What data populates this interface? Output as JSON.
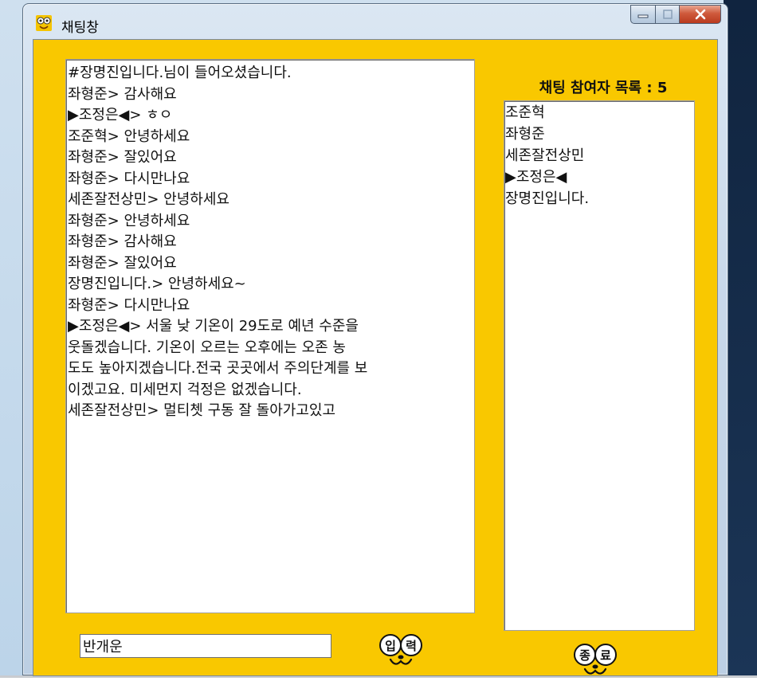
{
  "window": {
    "title": "채팅창",
    "minimize_glyph": "▬",
    "maximize_glyph": "□",
    "close_glyph": "X"
  },
  "chat": {
    "lines": [
      "#장명진입니다.님이 들어오셨습니다.",
      "좌형준> 감사해요",
      "▶조정은◀> ㅎㅇ",
      "조준혁> 안녕하세요",
      "좌형준> 잘있어요",
      "좌형준> 다시만나요",
      "세존잘전상민> 안녕하세요",
      "좌형준> 안녕하세요",
      "좌형준> 감사해요",
      "좌형준> 잘있어요",
      "장명진입니다.> 안녕하세요~",
      "좌형준> 다시만나요",
      "▶조정은◀> 서울 낮 기온이 29도로 예년 수준을",
      " 웃돌겠습니다. 기온이 오르는 오후에는 오존 농",
      "도도 높아지겠습니다.전국 곳곳에서 주의단계를 보",
      "이겠고요. 미세먼지 걱정은 없겠습니다.",
      "세존잘전상민> 멀티쳇 구동 잘 돌아가고있고"
    ]
  },
  "participants": {
    "title": "채팅 참여자 목록 : 5",
    "members": [
      "조준혁",
      "좌형준",
      "세존잘전상민",
      "▶조정은◀",
      "장명진입니다."
    ]
  },
  "input": {
    "value": "반개운"
  },
  "buttons": {
    "send_chars": [
      "입",
      "력"
    ],
    "quit_chars": [
      "종",
      "료"
    ]
  },
  "colors": {
    "panel_bg": "#f9c800",
    "close_button": "#c9452a"
  },
  "icons": {
    "app": "bee-face-icon",
    "send": "face-send-icon",
    "quit": "face-quit-icon"
  }
}
